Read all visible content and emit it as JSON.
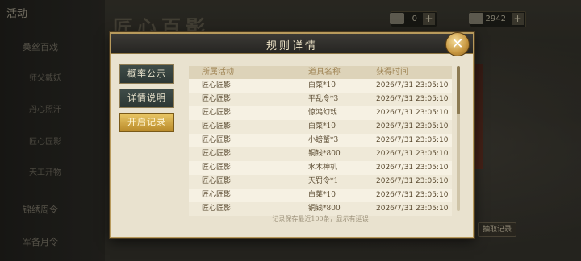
{
  "background": {
    "title": "活动",
    "menu": [
      {
        "label": "桑丝百戏"
      },
      {
        "label": "师父戴妖"
      },
      {
        "label": "丹心照汗"
      },
      {
        "label": "匠心匠影"
      },
      {
        "label": "天工开物"
      },
      {
        "label": "锦绣周令"
      },
      {
        "label": "军备月令"
      }
    ],
    "banner": "匠心百影",
    "currency_a": "0",
    "currency_b": "2942",
    "bottom_button": "抽取记录"
  },
  "dialog": {
    "title": "规则详情",
    "close_label": "✕",
    "tabs": [
      {
        "label": "概率公示",
        "active": false
      },
      {
        "label": "详情说明",
        "active": false
      },
      {
        "label": "开启记录",
        "active": true
      }
    ],
    "columns": [
      "所属活动",
      "道具名称",
      "获得时间"
    ],
    "rows": [
      [
        "匠心匠影",
        "白菜*10",
        "2026/7/31 23:05:10"
      ],
      [
        "匠心匠影",
        "平乱令*3",
        "2026/7/31 23:05:10"
      ],
      [
        "匠心匠影",
        "惊鸿幻戏",
        "2026/7/31 23:05:10"
      ],
      [
        "匠心匠影",
        "白菜*10",
        "2026/7/31 23:05:10"
      ],
      [
        "匠心匠影",
        "小螃蟹*3",
        "2026/7/31 23:05:10"
      ],
      [
        "匠心匠影",
        "铜钱*800",
        "2026/7/31 23:05:10"
      ],
      [
        "匠心匠影",
        "水木神机",
        "2026/7/31 23:05:10"
      ],
      [
        "匠心匠影",
        "天罚令*1",
        "2026/7/31 23:05:10"
      ],
      [
        "匠心匠影",
        "白菜*10",
        "2026/7/31 23:05:10"
      ],
      [
        "匠心匠影",
        "铜钱*800",
        "2026/7/31 23:05:10"
      ]
    ],
    "footer": "记录保存最近100条，显示有延误"
  }
}
